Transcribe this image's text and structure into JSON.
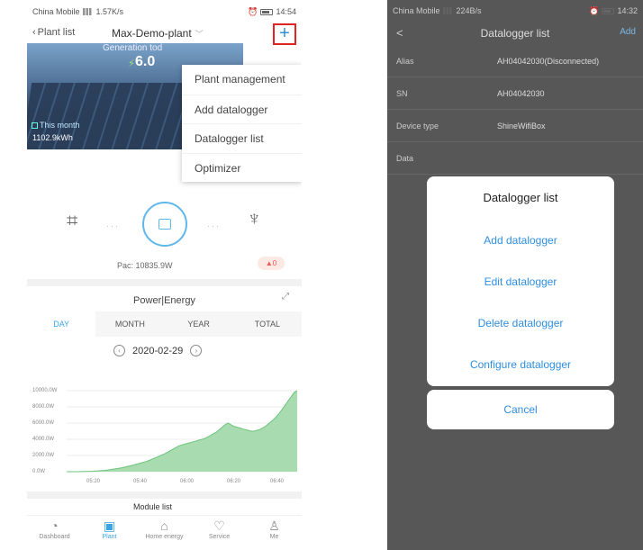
{
  "left": {
    "status": {
      "carrier": "China Mobile",
      "speed": "1.57K/s",
      "time": "14:54"
    },
    "nav": {
      "back": "Plant list",
      "title": "Max-Demo-plant",
      "add": "+"
    },
    "banner": {
      "gen_label": "Generation tod",
      "gen_value": "6.0",
      "month_label": "This month",
      "month_value": "1102.9kWh"
    },
    "menu": [
      "Plant management",
      "Add datalogger",
      "Datalogger list",
      "Optimizer"
    ],
    "pac": "Pac: 10835.9W",
    "alarm_count": "0",
    "power_energy_title": "Power|Energy",
    "tabs": [
      "DAY",
      "MONTH",
      "YEAR",
      "TOTAL"
    ],
    "date": "2020-02-29",
    "yticks": [
      "10000.0W",
      "8000.0W",
      "6000.0W",
      "4000.0W",
      "2000.0W",
      "0.0W"
    ],
    "xticks": [
      "05:20",
      "05:40",
      "06:00",
      "06:20",
      "06:40"
    ],
    "device_label": "Module list",
    "bottom_nav": [
      "Dashboard",
      "Plant",
      "Home energy",
      "Service",
      "Me"
    ],
    "chart_data": {
      "type": "area",
      "ylim": [
        0,
        10000
      ],
      "values": [
        0,
        0,
        0,
        0,
        0,
        10,
        20,
        30,
        40,
        60,
        80,
        100,
        130,
        160,
        200,
        240,
        300,
        360,
        420,
        480,
        560,
        640,
        720,
        800,
        900,
        1000,
        1100,
        1200,
        1300,
        1450,
        1600,
        1750,
        1900,
        2050,
        2200,
        2400,
        2600,
        2800,
        3000,
        3200,
        3300,
        3400,
        3500,
        3600,
        3700,
        3800,
        3900,
        4000,
        4100,
        4300,
        4500,
        4700,
        4900,
        5200,
        5500,
        5800,
        6000,
        5800,
        5600,
        5500,
        5400,
        5300,
        5200,
        5100,
        5000,
        5000,
        5100,
        5200,
        5400,
        5600,
        5900,
        6200,
        6500,
        6900,
        7300,
        7800,
        8300,
        8800,
        9300,
        9800,
        10500
      ]
    }
  },
  "right": {
    "status": {
      "carrier": "China Mobile",
      "speed": "224B/s",
      "time": "14:32"
    },
    "nav": {
      "back": "<",
      "title": "Datalogger list",
      "add": "Add"
    },
    "rows": [
      {
        "k": "Alias",
        "v": "AH04042030(Disconnected)"
      },
      {
        "k": "SN",
        "v": "AH04042030"
      },
      {
        "k": "Device type",
        "v": "ShineWifiBox"
      },
      {
        "k": "Data",
        "v": ""
      }
    ],
    "modal": {
      "title": "Datalogger list",
      "options": [
        "Add datalogger",
        "Edit datalogger",
        "Delete datalogger",
        "Configure datalogger"
      ],
      "cancel": "Cancel"
    }
  }
}
